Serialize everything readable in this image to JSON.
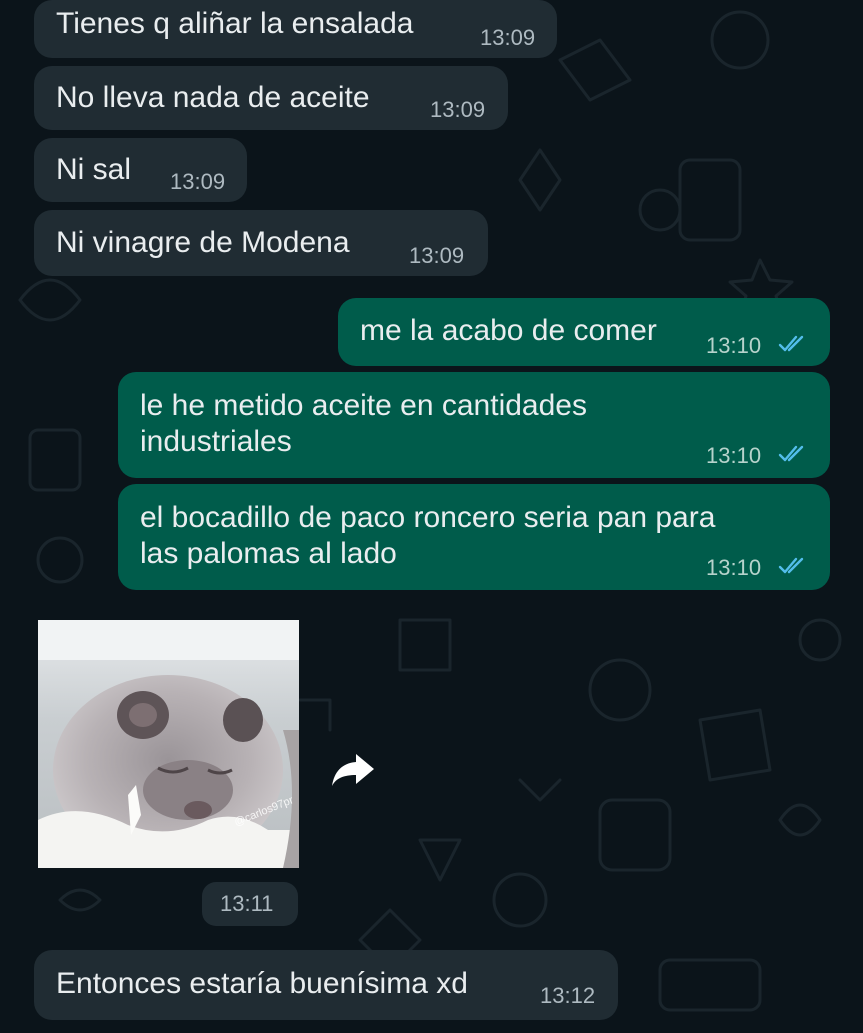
{
  "messages": [
    {
      "direction": "incoming",
      "text": "Tienes q aliñar la ensalada",
      "time": "13:09"
    },
    {
      "direction": "incoming",
      "text": "No lleva nada de aceite",
      "time": "13:09"
    },
    {
      "direction": "incoming",
      "text": "Ni sal",
      "time": "13:09"
    },
    {
      "direction": "incoming",
      "text": "Ni vinagre de Modena",
      "time": "13:09"
    },
    {
      "direction": "outgoing",
      "text": "me la acabo de comer",
      "time": "13:10",
      "status": "read"
    },
    {
      "direction": "outgoing",
      "text": "le he metido aceite en cantidades\nindustriales",
      "time": "13:10",
      "status": "read"
    },
    {
      "direction": "outgoing",
      "text": "el bocadillo de paco roncero seria pan para\nlas palomas al lado",
      "time": "13:10",
      "status": "read"
    },
    {
      "direction": "incoming",
      "type": "image",
      "time": "13:11",
      "watermark": "@carlos97pr"
    },
    {
      "direction": "incoming",
      "text": "Entonces estaría buenísima xd",
      "time": "13:12"
    }
  ],
  "colors": {
    "background": "#0b141a",
    "incoming_bubble": "#202c33",
    "outgoing_bubble": "#005c4b",
    "read_ticks": "#53bdeb"
  },
  "icons": {
    "forward": "forward-arrow-icon",
    "read_status": "double-check-icon"
  }
}
